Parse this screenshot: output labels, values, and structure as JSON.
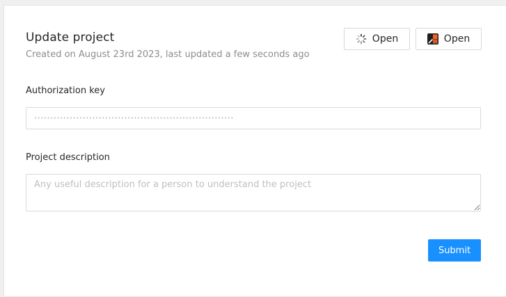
{
  "header": {
    "title": "Update project",
    "subtitle": "Created on August 23rd 2023, last updated a few seconds ago"
  },
  "actions": {
    "open_primary_label": "Open",
    "open_secondary_label": "Open",
    "open_primary_icon": "loading-spinner-icon",
    "open_secondary_icon": "app-logo-icon"
  },
  "form": {
    "auth_key_label": "Authorization key",
    "auth_key_value": "••••••••••••••••••••••••••••••••••••••••••••••••••••••••••••••",
    "description_label": "Project description",
    "description_placeholder": "Any useful description for a person to understand the project",
    "submit_label": "Submit"
  },
  "colors": {
    "accent": "#1890ff",
    "logo_dark": "#1f1f1f",
    "logo_orange": "#f5632a"
  }
}
